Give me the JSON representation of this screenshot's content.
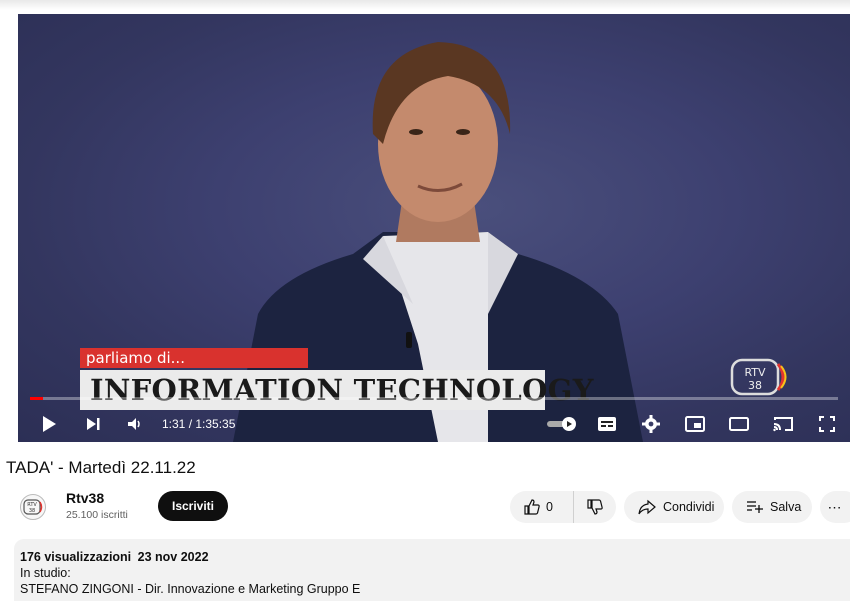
{
  "player": {
    "overlay_small_label": "parliamo di...",
    "overlay_main_label": "INFORMATION TECHNOLOGY",
    "logo_text": "RTV 38",
    "progress_fraction": 0.016,
    "time_display": "1:31 / 1:35:35",
    "icons": [
      "play-icon",
      "next-icon",
      "volume-icon",
      "autoplay-toggle",
      "subtitles-icon",
      "settings-icon",
      "miniplayer-icon",
      "theater-icon",
      "cast-icon",
      "fullscreen-icon"
    ]
  },
  "video": {
    "title": "TADA' - Martedì 22.11.22"
  },
  "channel": {
    "name": "Rtv38",
    "subscribers": "25.100 iscritti",
    "subscribe_label": "Iscriviti"
  },
  "actions": {
    "like_count": "0",
    "share_label": "Condividi",
    "save_label": "Salva"
  },
  "description": {
    "views": "176 visualizzazioni",
    "date": "23 nov 2022",
    "line1": "In studio:",
    "line2": "STEFANO ZINGONI  - Dir. Innovazione e Marketing Gruppo E"
  },
  "colors": {
    "progress": "#ff0000",
    "overlay_red": "#d9322e",
    "subscribe_bg": "#0f0f0f"
  }
}
